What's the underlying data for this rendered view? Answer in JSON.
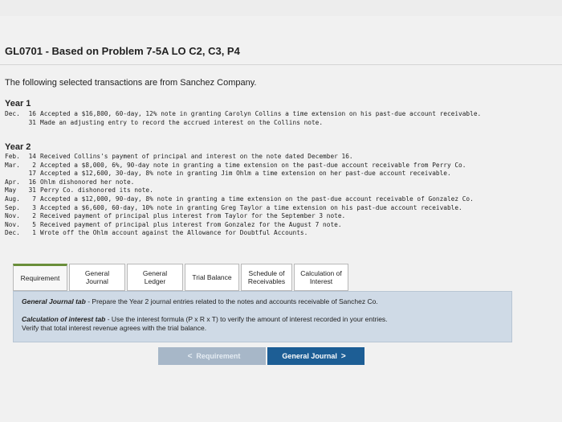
{
  "header": {
    "title": "GL0701 - Based on Problem 7-5A LO C2, C3, P4"
  },
  "intro": "The following selected transactions are from Sanchez Company.",
  "year1": {
    "heading": "Year 1",
    "rows": [
      {
        "mon": "Dec.",
        "day": "16",
        "desc": "Accepted a $16,800, 60-day, 12% note in granting Carolyn Collins a time extension on his past-due account receivable."
      },
      {
        "mon": "",
        "day": "31",
        "desc": "Made an adjusting entry to record the accrued interest on the Collins note."
      }
    ]
  },
  "year2": {
    "heading": "Year 2",
    "rows": [
      {
        "mon": "Feb.",
        "day": "14",
        "desc": "Received Collins's payment of principal and interest on the note dated December 16."
      },
      {
        "mon": "Mar.",
        "day": "2",
        "desc": "Accepted a $8,000, 6%, 90-day note in granting a time extension on the past-due account receivable from Perry Co."
      },
      {
        "mon": "",
        "day": "17",
        "desc": "Accepted a $12,600, 30-day, 8% note in granting Jim Ohlm a time extension on her past-due account receivable."
      },
      {
        "mon": "Apr.",
        "day": "16",
        "desc": "Ohlm dishonored her note."
      },
      {
        "mon": "May",
        "day": "31",
        "desc": "Perry Co. dishonored its note."
      },
      {
        "mon": "Aug.",
        "day": "7",
        "desc": "Accepted a $12,000, 90-day, 8% note in granting a time extension on the past-due account receivable of Gonzalez Co."
      },
      {
        "mon": "Sep.",
        "day": "3",
        "desc": "Accepted a $6,600, 60-day, 10% note in granting Greg Taylor a time extension on his past-due account receivable."
      },
      {
        "mon": "Nov.",
        "day": "2",
        "desc": "Received payment of principal plus interest from Taylor for the September 3 note."
      },
      {
        "mon": "Nov.",
        "day": "5",
        "desc": "Received payment of principal plus interest from Gonzalez for the August 7 note."
      },
      {
        "mon": "Dec.",
        "day": "1",
        "desc": "Wrote off the Ohlm account against the Allowance for Doubtful Accounts."
      }
    ]
  },
  "tabs": [
    {
      "line1": "Requirement",
      "line2": ""
    },
    {
      "line1": "General",
      "line2": "Journal"
    },
    {
      "line1": "General",
      "line2": "Ledger"
    },
    {
      "line1": "Trial Balance",
      "line2": ""
    },
    {
      "line1": "Schedule of",
      "line2": "Receivables"
    },
    {
      "line1": "Calculation of",
      "line2": "Interest"
    }
  ],
  "panel": {
    "line1_label": "General Journal tab",
    "line1_text": " - Prepare the Year 2 journal entries related to the notes and accounts receivable of Sanchez Co.",
    "line2_label": "Calculation of interest tab",
    "line2_text": " - Use the interest formula (P x R x T) to verify the amount of interest recorded in your entries.",
    "line3_text": "Verify that total interest revenue agrees with the trial balance."
  },
  "nav": {
    "prev_label": "Requirement",
    "next_label": "General Journal",
    "prev_chevron": "<",
    "next_chevron": ">"
  },
  "colors": {
    "accent": "#1d5e95",
    "panel_bg": "#cfdae6",
    "active_tab_border": "#6a8f3a"
  }
}
